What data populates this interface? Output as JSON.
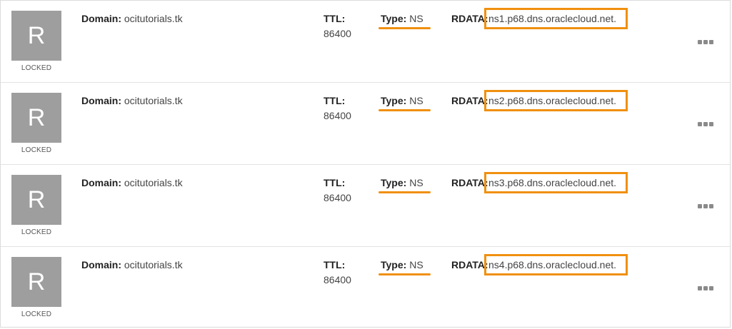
{
  "records": [
    {
      "avatar_letter": "R",
      "status": "LOCKED",
      "domain_label": "Domain:",
      "domain": "ocitutorials.tk",
      "ttl_label": "TTL:",
      "ttl": "86400",
      "type_label": "Type:",
      "type": "NS",
      "rdata_label": "RDATA:",
      "rdata": "ns1.p68.dns.oraclecloud.net."
    },
    {
      "avatar_letter": "R",
      "status": "LOCKED",
      "domain_label": "Domain:",
      "domain": "ocitutorials.tk",
      "ttl_label": "TTL:",
      "ttl": "86400",
      "type_label": "Type:",
      "type": "NS",
      "rdata_label": "RDATA:",
      "rdata": "ns2.p68.dns.oraclecloud.net."
    },
    {
      "avatar_letter": "R",
      "status": "LOCKED",
      "domain_label": "Domain:",
      "domain": "ocitutorials.tk",
      "ttl_label": "TTL:",
      "ttl": "86400",
      "type_label": "Type:",
      "type": "NS",
      "rdata_label": "RDATA:",
      "rdata": "ns3.p68.dns.oraclecloud.net."
    },
    {
      "avatar_letter": "R",
      "status": "LOCKED",
      "domain_label": "Domain:",
      "domain": "ocitutorials.tk",
      "ttl_label": "TTL:",
      "ttl": "86400",
      "type_label": "Type:",
      "type": "NS",
      "rdata_label": "RDATA:",
      "rdata": "ns4.p68.dns.oraclecloud.net."
    }
  ],
  "icons": {
    "actions_menu": "more-horizontal-icon"
  },
  "colors": {
    "highlight": "#f0900f",
    "avatar_bg": "#9e9e9e",
    "menu_dots": "#8a8a8a"
  }
}
